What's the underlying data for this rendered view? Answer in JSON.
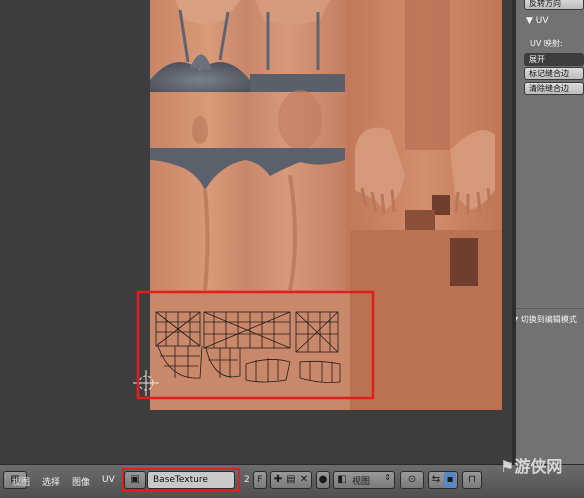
{
  "right_panel": {
    "top_button": "反转方向",
    "section_title": "UV",
    "uv_map_label": "UV 映射:",
    "unwrap_button": "展开",
    "mark_seam_button": "标记缝合边",
    "clear_seam_button": "清除缝合边",
    "edit_mode_panel": "切换到编辑模式"
  },
  "footer": {
    "menu": [
      "视图",
      "选择",
      "图像",
      "UV"
    ],
    "image_name": "BaseTexture",
    "user_count": "2",
    "fake_user": "F",
    "view_select": "视图"
  },
  "watermark": "游侠网",
  "colors": {
    "highlight_box": "#e01e1e",
    "skin": "#c98a68",
    "bra": "#5f6570"
  }
}
